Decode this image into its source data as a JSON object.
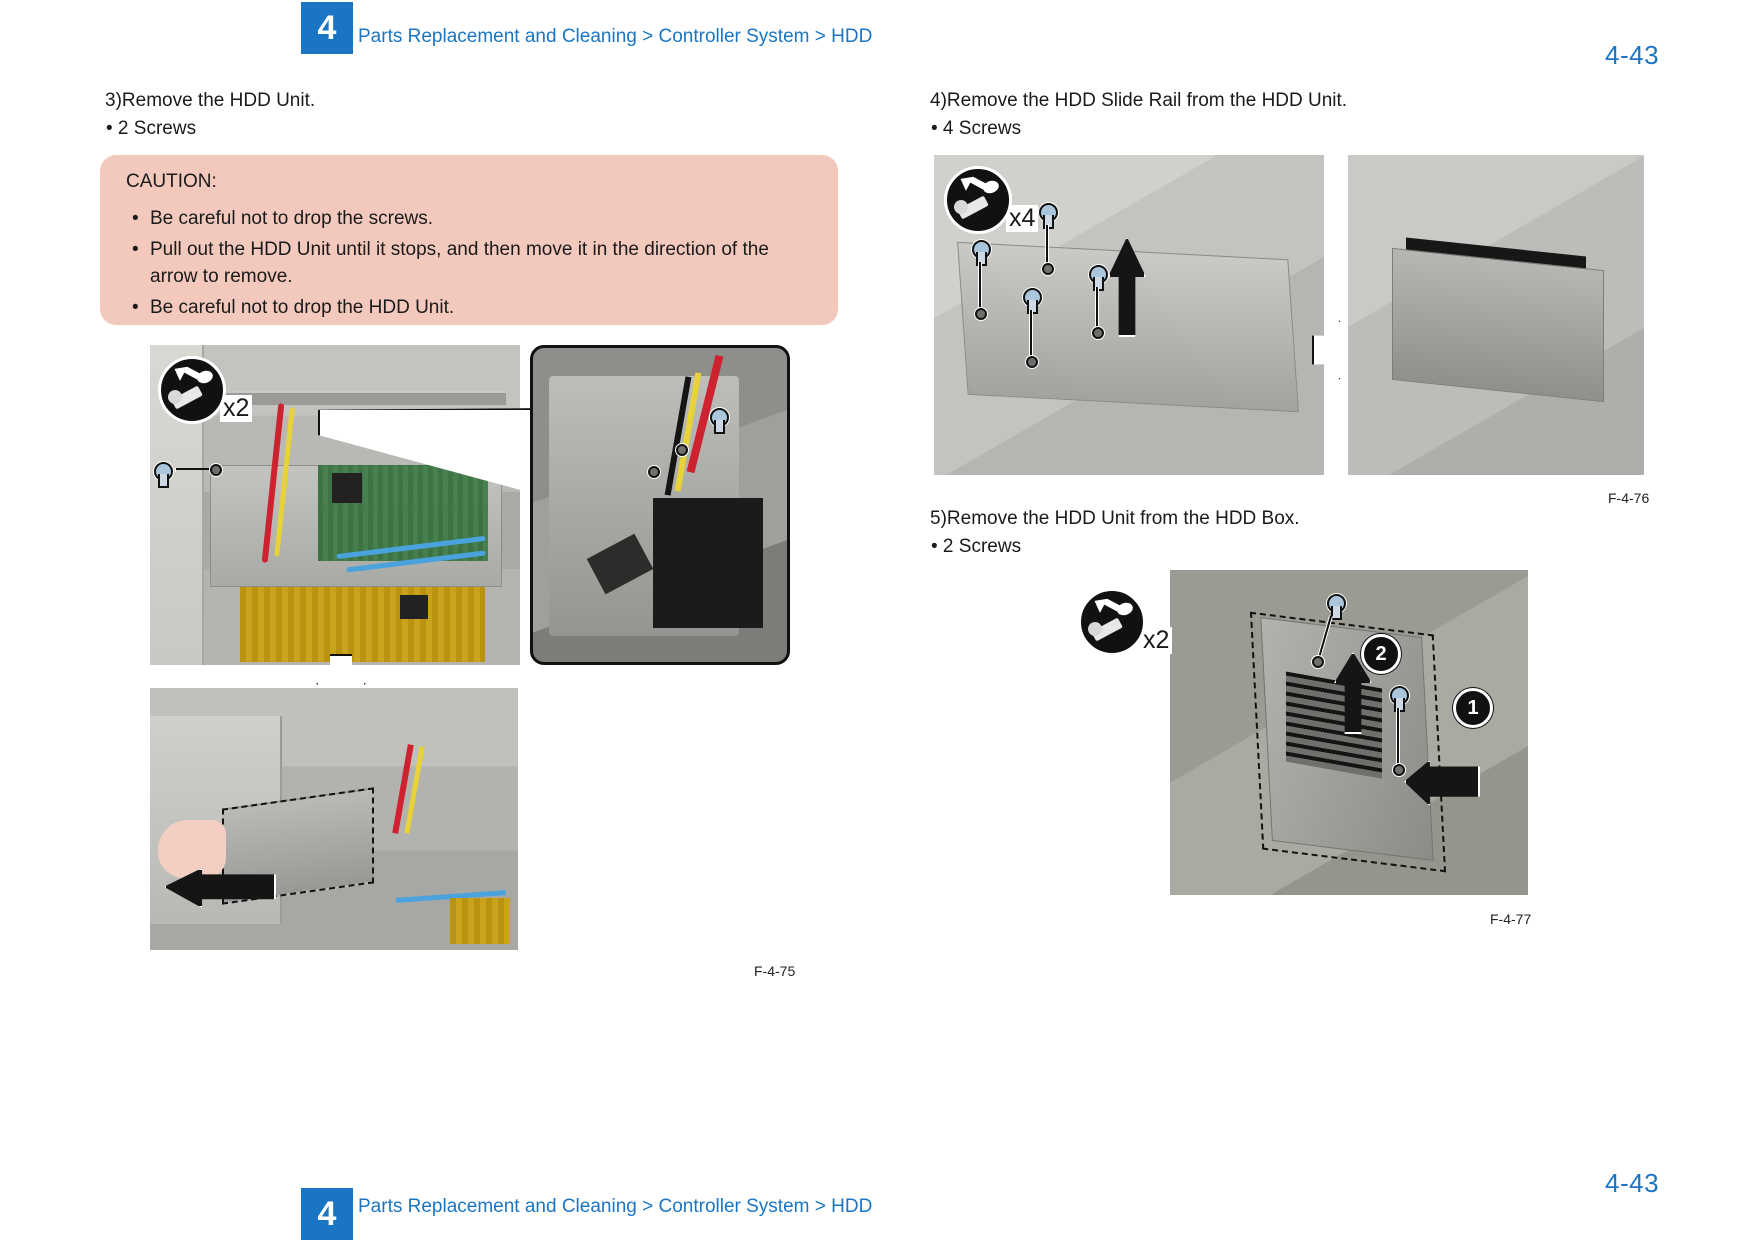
{
  "header": {
    "chapter": "4",
    "breadcrumb": "Parts Replacement and Cleaning > Controller System > HDD",
    "page_number": "4-43"
  },
  "footer": {
    "chapter": "4",
    "breadcrumb": "Parts Replacement and Cleaning > Controller System > HDD",
    "page_number": "4-43"
  },
  "steps": [
    {
      "id": "step3",
      "number": "3)",
      "text": "Remove the HDD Unit.",
      "bullet": "•  2 Screws"
    },
    {
      "id": "step4",
      "number": "4)",
      "text": "Remove the HDD Slide Rail from the HDD Unit.",
      "bullet": "•  4 Screws"
    },
    {
      "id": "step5",
      "number": "5)",
      "text": "Remove the HDD Unit from the HDD Box.",
      "bullet": "•  2 Screws"
    }
  ],
  "caution": {
    "title": "CAUTION:",
    "items": [
      "Be careful not to drop the screws.",
      "Pull out the HDD Unit until it stops, and then move it in the direction of the arrow to remove.",
      "Be careful not to drop the HDD Unit."
    ],
    "background_color": "#f2c9bc"
  },
  "figures": [
    {
      "caption": "F-4-75"
    },
    {
      "caption": "F-4-76"
    },
    {
      "caption": "F-4-77"
    }
  ],
  "badges": {
    "screws_step3": "x2",
    "screws_step4": "x4",
    "screws_step5": "x2"
  },
  "callouts": {
    "one": "1",
    "two": "2"
  },
  "colors": {
    "accent_blue": "#1a76c4",
    "caution_pink": "#f2c9bc",
    "text": "#1a1a1a"
  }
}
